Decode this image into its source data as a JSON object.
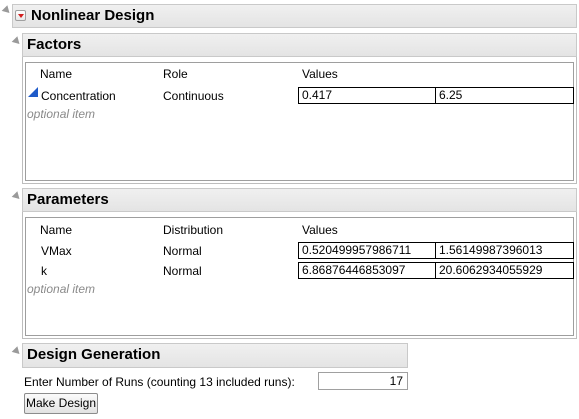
{
  "title": "Nonlinear Design",
  "factors": {
    "header": "Factors",
    "columns": {
      "name": "Name",
      "role": "Role",
      "values": "Values"
    },
    "rows": [
      {
        "name": "Concentration",
        "role": "Continuous",
        "low": "0.417",
        "high": "6.25"
      }
    ],
    "optional": "optional item"
  },
  "parameters": {
    "header": "Parameters",
    "columns": {
      "name": "Name",
      "distribution": "Distribution",
      "values": "Values"
    },
    "rows": [
      {
        "name": "VMax",
        "distribution": "Normal",
        "low": "0.520499957986711",
        "high": "1.56149987396013"
      },
      {
        "name": "k",
        "distribution": "Normal",
        "low": "6.86876446853097",
        "high": "20.6062934055929"
      }
    ],
    "optional": "optional item"
  },
  "generation": {
    "header": "Design Generation",
    "runs_label": "Enter Number of Runs (counting 13 included runs):",
    "runs_value": "17",
    "make_button": "Make Design"
  }
}
